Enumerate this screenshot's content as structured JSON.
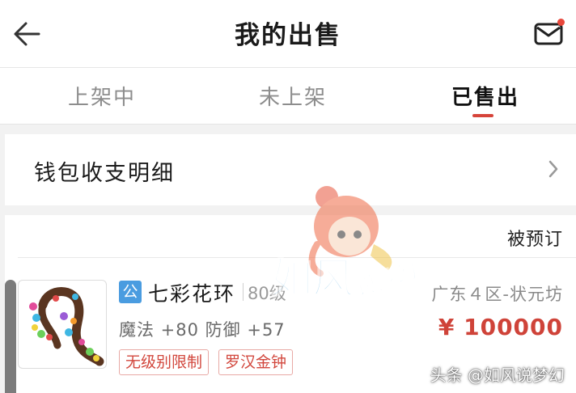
{
  "header": {
    "title": "我的出售",
    "back_icon": "arrow-left-icon",
    "mail_icon": "mail-icon",
    "notify_color": "#e8473b"
  },
  "tabs": [
    {
      "label": "上架中",
      "active": false
    },
    {
      "label": "未上架",
      "active": false
    },
    {
      "label": "已售出",
      "active": true
    }
  ],
  "wallet": {
    "label": "钱包收支明细",
    "icon": "chevron-right-icon"
  },
  "order": {
    "status": "被预订",
    "server_badge": "公",
    "item_name": "七彩花环",
    "level": "80级",
    "stats": "魔法 +80 防御 +57",
    "tags": [
      "无级别限制",
      "罗汉金钟"
    ],
    "server": "广东４区-状元坊",
    "price": "¥ 100000",
    "accent_color": "#cf4339"
  },
  "watermark": {
    "logo_text": "如风",
    "logo_subtext": "说梦幻",
    "footer": "头条 @如风说梦幻"
  }
}
